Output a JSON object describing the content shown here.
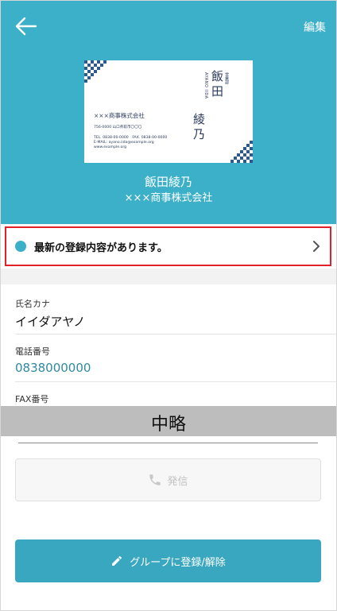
{
  "header": {
    "edit_label": "編集",
    "name": "飯田綾乃",
    "company": "×××商事株式会社"
  },
  "business_card": {
    "company": "×××商事株式会社",
    "address": "756-0000 山口県萩市〇〇〇",
    "tel_fax": "TEL. 0838-00-0000　FAX. 0838-00-0000",
    "email": "E-MAIL: ayano.iida@example.org",
    "web": "www.example.org",
    "department": "営業部",
    "roman_name": "AYANO IIDA",
    "surname": "飯田",
    "given_name": "綾乃"
  },
  "notice": {
    "text": "最新の登録内容があります。"
  },
  "details": {
    "kana_label": "氏名カナ",
    "kana_value": "イイダアヤノ",
    "phone_label": "電話番号",
    "phone_value": "0838000000",
    "fax_label": "FAX番号"
  },
  "omission": {
    "label": "中略"
  },
  "actions": {
    "call_label": "発信",
    "group_label": "グループに登録/解除"
  },
  "colors": {
    "brand": "#3cb0c8",
    "highlight_border": "#e0202c",
    "card_ink": "#2a3b5c",
    "link": "#2f8aa0"
  }
}
